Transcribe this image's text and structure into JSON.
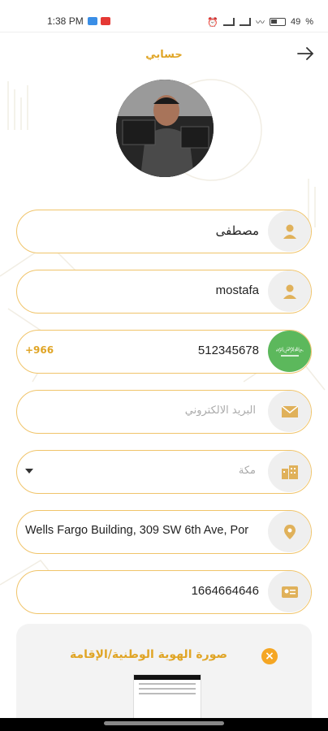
{
  "status_bar": {
    "time": "1:38 PM",
    "battery": "49"
  },
  "header": {
    "title": "حسابي"
  },
  "fields": {
    "name": {
      "value": "مصطفى"
    },
    "username": {
      "value": "mostafa"
    },
    "phone": {
      "code": "+966",
      "value": "512345678"
    },
    "email": {
      "placeholder": "البريد الالكتروني"
    },
    "city": {
      "placeholder": "مكة"
    },
    "address": {
      "value": "Wells Fargo Building, 309 SW 6th Ave, Por"
    },
    "id_number": {
      "value": "1664664646"
    }
  },
  "id_card": {
    "title": "صورة الهوية الوطنية/الإقامة"
  },
  "colors": {
    "accent": "#e0a526",
    "border": "#f0c46a",
    "icon_bg": "#efefef",
    "flag_green": "#5cb85c"
  }
}
